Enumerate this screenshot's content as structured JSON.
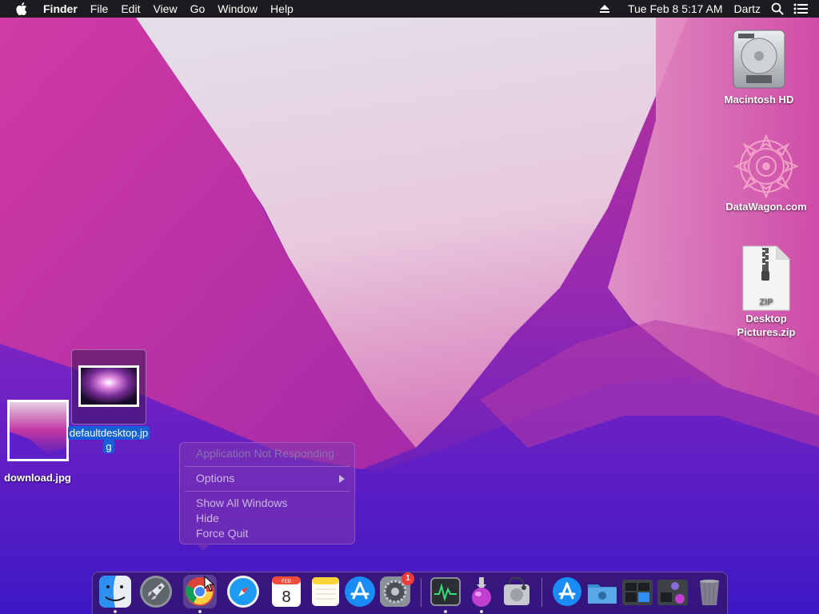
{
  "menubar": {
    "app_name": "Finder",
    "menus": [
      "File",
      "Edit",
      "View",
      "Go",
      "Window",
      "Help"
    ],
    "date_time": "Tue Feb 8  5:17 AM",
    "user": "Dartz"
  },
  "desktop": {
    "icons": [
      {
        "label": "Macintosh HD"
      },
      {
        "label": "DataWagon.com"
      },
      {
        "label": "Desktop Pictures.zip",
        "line1": "Desktop",
        "line2": "Pictures.zip",
        "badge_text": "ZIP"
      },
      {
        "label": "download.jpg"
      },
      {
        "label": "defaultdesktop.jpg",
        "line1": "defaultdesktop.jp",
        "line2": "g"
      }
    ]
  },
  "context_menu": {
    "status": "Application Not Responding",
    "options": "Options",
    "show_all": "Show All Windows",
    "hide": "Hide",
    "force_quit": "Force Quit"
  },
  "dock": {
    "apps": [
      {
        "name": "Finder",
        "icon": "finder-icon",
        "running": true
      },
      {
        "name": "Launchpad",
        "icon": "rocket-icon",
        "running": false
      },
      {
        "name": "Google Chrome",
        "icon": "chrome-icon",
        "running": true
      },
      {
        "name": "Safari",
        "icon": "compass-icon",
        "running": false
      },
      {
        "name": "Calendar",
        "icon": "calendar-icon",
        "running": false,
        "month": "FEB",
        "day": "8"
      },
      {
        "name": "Notes",
        "icon": "notes-icon",
        "running": false
      },
      {
        "name": "App Store",
        "icon": "app-store-icon",
        "running": false
      },
      {
        "name": "System Preferences",
        "icon": "gear-icon",
        "running": false,
        "badge": "1"
      },
      {
        "name": "Activity Monitor",
        "icon": "activity-monitor-icon",
        "running": true
      },
      {
        "name": "Installer",
        "icon": "installer-icon",
        "running": true
      },
      {
        "name": "Disk Utility",
        "icon": "disk-utility-icon",
        "running": false
      },
      {
        "name": "Applications",
        "icon": "app-store-icon",
        "running": false
      },
      {
        "name": "Downloads",
        "icon": "folder-icon",
        "running": false
      },
      {
        "name": "Recent Apps",
        "icon": "stack-icon",
        "running": false
      },
      {
        "name": "Utilities",
        "icon": "stack-icon",
        "running": false
      },
      {
        "name": "Trash",
        "icon": "trash-icon",
        "running": false
      }
    ]
  },
  "colors": {
    "menubar": "#1d1b1f",
    "wallpaper_top": "#e8d6e6",
    "wallpaper_mid": "#c0229a",
    "wallpaper_bottom": "#4b1cc6",
    "selection": "#1360d8"
  }
}
